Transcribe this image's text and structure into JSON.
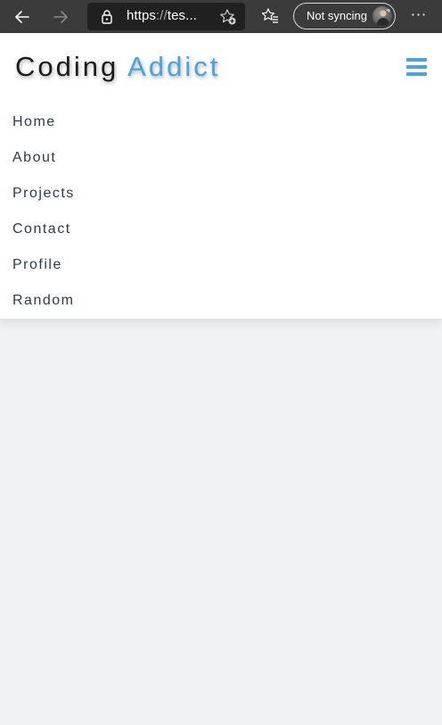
{
  "browser": {
    "url_protocol": "https",
    "url_separator": "://",
    "url_rest": "tes...",
    "sync_label": "Not syncing",
    "more_label": "···"
  },
  "header": {
    "logo_word1": "Coding",
    "logo_word2": "Addict"
  },
  "nav": {
    "items": [
      {
        "label": "Home"
      },
      {
        "label": "About"
      },
      {
        "label": "Projects"
      },
      {
        "label": "Contact"
      },
      {
        "label": "Profile"
      },
      {
        "label": "Random"
      }
    ]
  },
  "colors": {
    "accent": "#4aa3dc",
    "nav_text": "#2e3b4e",
    "page_bg": "#f0f3f6",
    "browser_bar": "#3b3b3b"
  },
  "icons": [
    "back-arrow-icon",
    "forward-arrow-icon",
    "lock-icon",
    "add-favorite-icon",
    "favorites-icon",
    "profile-avatar",
    "more-icon",
    "hamburger-icon"
  ]
}
